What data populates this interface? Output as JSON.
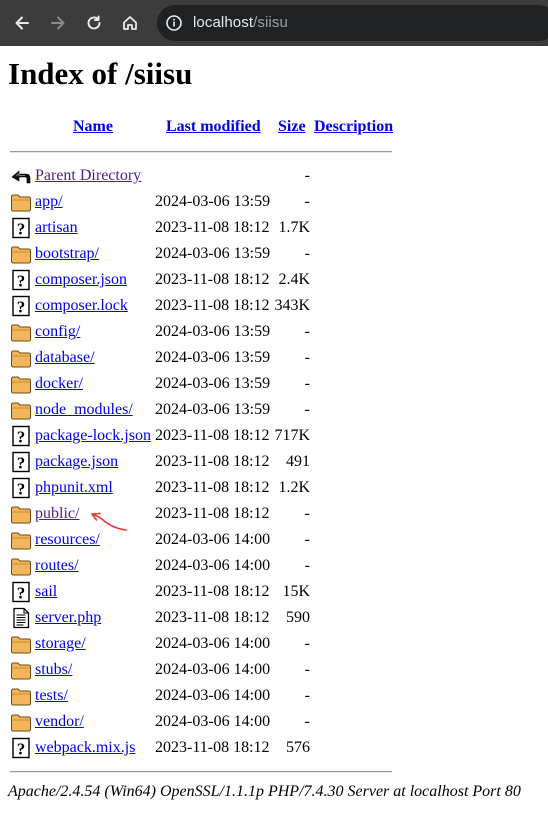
{
  "browser": {
    "url_host": "localhost",
    "url_path": "/siisu"
  },
  "page": {
    "title": "Index of /siisu",
    "columns": {
      "name": "Name",
      "last_modified": "Last modified",
      "size": "Size",
      "description": "Description"
    },
    "parent": {
      "label": "Parent Directory",
      "size": "-"
    },
    "entries": [
      {
        "name": "app/",
        "modified": "2024-03-06 13:59",
        "size": "-",
        "icon": "folder-icon"
      },
      {
        "name": "artisan",
        "modified": "2023-11-08 18:12",
        "size": "1.7K",
        "icon": "unknown-file-icon"
      },
      {
        "name": "bootstrap/",
        "modified": "2024-03-06 13:59",
        "size": "-",
        "icon": "folder-icon"
      },
      {
        "name": "composer.json",
        "modified": "2023-11-08 18:12",
        "size": "2.4K",
        "icon": "unknown-file-icon"
      },
      {
        "name": "composer.lock",
        "modified": "2023-11-08 18:12",
        "size": "343K",
        "icon": "unknown-file-icon"
      },
      {
        "name": "config/",
        "modified": "2024-03-06 13:59",
        "size": "-",
        "icon": "folder-icon"
      },
      {
        "name": "database/",
        "modified": "2024-03-06 13:59",
        "size": "-",
        "icon": "folder-icon"
      },
      {
        "name": "docker/",
        "modified": "2024-03-06 13:59",
        "size": "-",
        "icon": "folder-icon"
      },
      {
        "name": "node_modules/",
        "modified": "2024-03-06 13:59",
        "size": "-",
        "icon": "folder-icon"
      },
      {
        "name": "package-lock.json",
        "modified": "2023-11-08 18:12",
        "size": "717K",
        "icon": "unknown-file-icon"
      },
      {
        "name": "package.json",
        "modified": "2023-11-08 18:12",
        "size": "491",
        "icon": "unknown-file-icon"
      },
      {
        "name": "phpunit.xml",
        "modified": "2023-11-08 18:12",
        "size": "1.2K",
        "icon": "unknown-file-icon"
      },
      {
        "name": "public/",
        "modified": "2023-11-08 18:12",
        "size": "-",
        "icon": "folder-icon",
        "visited": true
      },
      {
        "name": "resources/",
        "modified": "2024-03-06 14:00",
        "size": "-",
        "icon": "folder-icon"
      },
      {
        "name": "routes/",
        "modified": "2024-03-06 14:00",
        "size": "-",
        "icon": "folder-icon"
      },
      {
        "name": "sail",
        "modified": "2023-11-08 18:12",
        "size": "15K",
        "icon": "unknown-file-icon"
      },
      {
        "name": "server.php",
        "modified": "2023-11-08 18:12",
        "size": "590",
        "icon": "text-file-icon"
      },
      {
        "name": "storage/",
        "modified": "2024-03-06 14:00",
        "size": "-",
        "icon": "folder-icon"
      },
      {
        "name": "stubs/",
        "modified": "2024-03-06 14:00",
        "size": "-",
        "icon": "folder-icon"
      },
      {
        "name": "tests/",
        "modified": "2024-03-06 14:00",
        "size": "-",
        "icon": "folder-icon"
      },
      {
        "name": "vendor/",
        "modified": "2024-03-06 14:00",
        "size": "-",
        "icon": "folder-icon"
      },
      {
        "name": "webpack.mix.js",
        "modified": "2023-11-08 18:12",
        "size": "576",
        "icon": "unknown-file-icon"
      }
    ],
    "footer": "Apache/2.4.54 (Win64) OpenSSL/1.1.1p PHP/7.4.30 Server at localhost Port 80"
  },
  "colors": {
    "toolbar": "#3c3c3c",
    "link": "#0000ee",
    "visited_link": "#551a8b",
    "annotation": "#e53935"
  }
}
